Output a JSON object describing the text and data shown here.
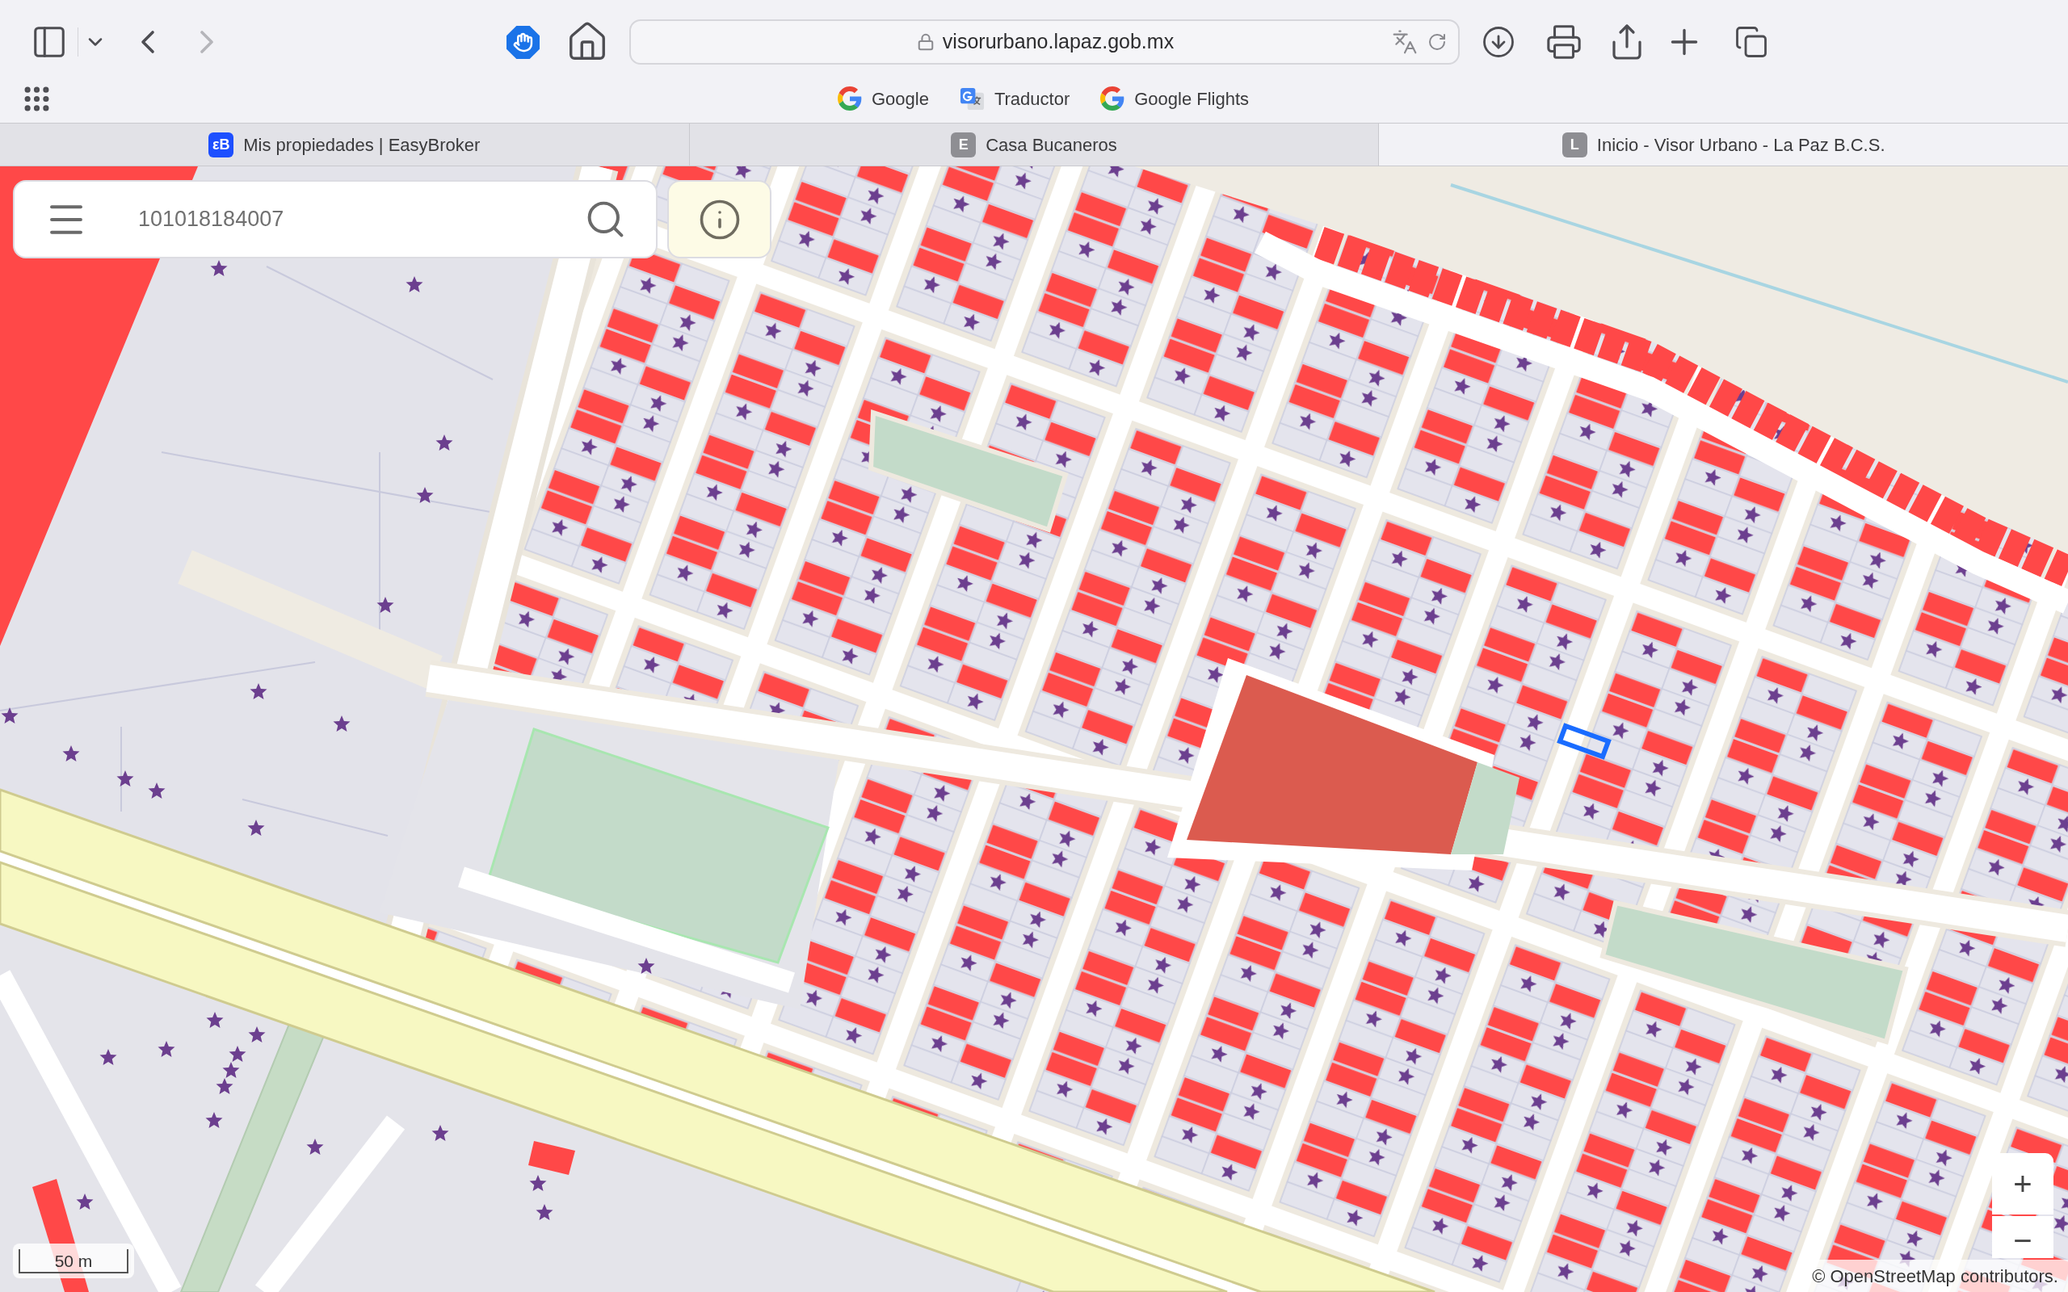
{
  "browser": {
    "navigation": {
      "back_enabled": true,
      "forward_enabled": false
    },
    "address_bar": {
      "url": "visorurbano.lapaz.gob.mx",
      "secure": true
    },
    "bookmarks": [
      {
        "label": "Google",
        "kind": "google"
      },
      {
        "label": "Traductor",
        "kind": "translate"
      },
      {
        "label": "Google Flights",
        "kind": "google"
      }
    ],
    "tabs": [
      {
        "title": "Mis propiedades | EasyBroker",
        "favicon": {
          "text": "εB",
          "color": "#1d4fff"
        },
        "selected": false
      },
      {
        "title": "Casa Bucaneros",
        "favicon": {
          "text": "E",
          "color": "#8e8e93"
        },
        "selected": false
      },
      {
        "title": "Inicio - Visor Urbano - La Paz B.C.S.",
        "favicon": {
          "text": "L",
          "color": "#8e8e93"
        },
        "selected": true
      }
    ]
  },
  "map": {
    "search": {
      "value": "101018184007"
    },
    "zoom_controls": [
      {
        "label": "+"
      },
      {
        "label": "−"
      }
    ],
    "scale_bar": {
      "label": "50 m"
    },
    "attribution": "© OpenStreetMap contributors."
  }
}
